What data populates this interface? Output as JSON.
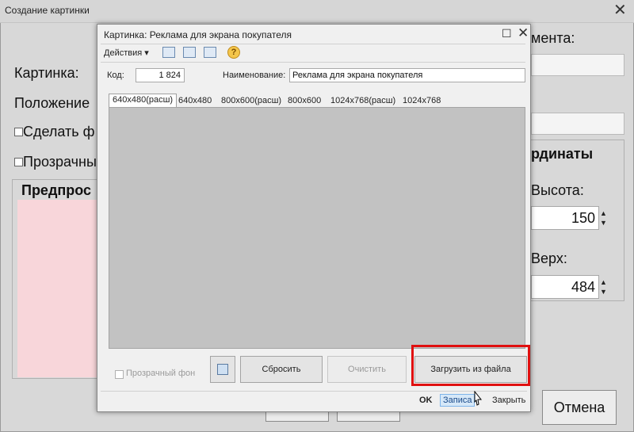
{
  "background_window": {
    "title": "Создание картинки",
    "close_label": "✕",
    "element_label": "мента:",
    "picture_label": "Картинка:",
    "position_label": "Положение",
    "checkbox_make_label": "Сделать ф",
    "checkbox_transparent_label": "Прозрачны",
    "preview_label": "Предпрос",
    "coords_label": "рдинаты",
    "height_label": "Высота:",
    "height_value": "150",
    "top_label": "Верх:",
    "top_value": "484",
    "cancel_label": "Отмена"
  },
  "modal": {
    "title": "Картинка: Реклама для экрана покупателя",
    "maximize_label": "☐",
    "close_label": "✕",
    "toolbar": {
      "actions_label": "Действия ▾",
      "help_label": "?"
    },
    "code_label": "Код:",
    "code_value": "1 824",
    "name_label": "Наименование:",
    "name_value": "Реклама для экрана покупателя",
    "tabs": [
      {
        "label": "640x480(расш)",
        "active": true
      },
      {
        "label": "640x480",
        "active": false
      },
      {
        "label": "800x600(расш)",
        "active": false
      },
      {
        "label": "800x600",
        "active": false
      },
      {
        "label": "1024x768(расш)",
        "active": false
      },
      {
        "label": "1024x768",
        "active": false
      }
    ],
    "transparent_bg_label": "Прозрачный фон",
    "reset_label": "Сбросить",
    "clear_label": "Очистить",
    "load_from_file_label": "Загрузить из файла",
    "ok_label": "OK",
    "save_label": "Записа",
    "close_button_label": "Закрыть"
  },
  "colors": {
    "preview_fill": "#f8d6da",
    "highlight_border": "#e01010",
    "image_panel": "#c2c2c2"
  }
}
